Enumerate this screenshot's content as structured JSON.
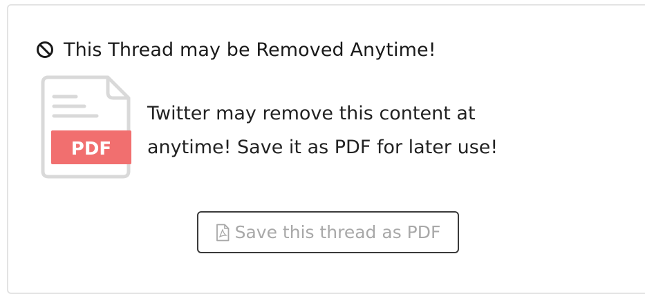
{
  "notice": {
    "title": "This Thread may be Removed Anytime!",
    "title_icon": "ban-icon",
    "message_lines": [
      "Twitter may remove this content at",
      "anytime! Save it as PDF for later use!"
    ]
  },
  "illustration": {
    "icon": "pdf-file-icon",
    "badge_text": "PDF",
    "badge_color": "#f16f6f",
    "outline_color": "#d9d9d9"
  },
  "actions": {
    "save_label": "Save this thread as PDF",
    "save_icon": "pdf-file-icon"
  }
}
